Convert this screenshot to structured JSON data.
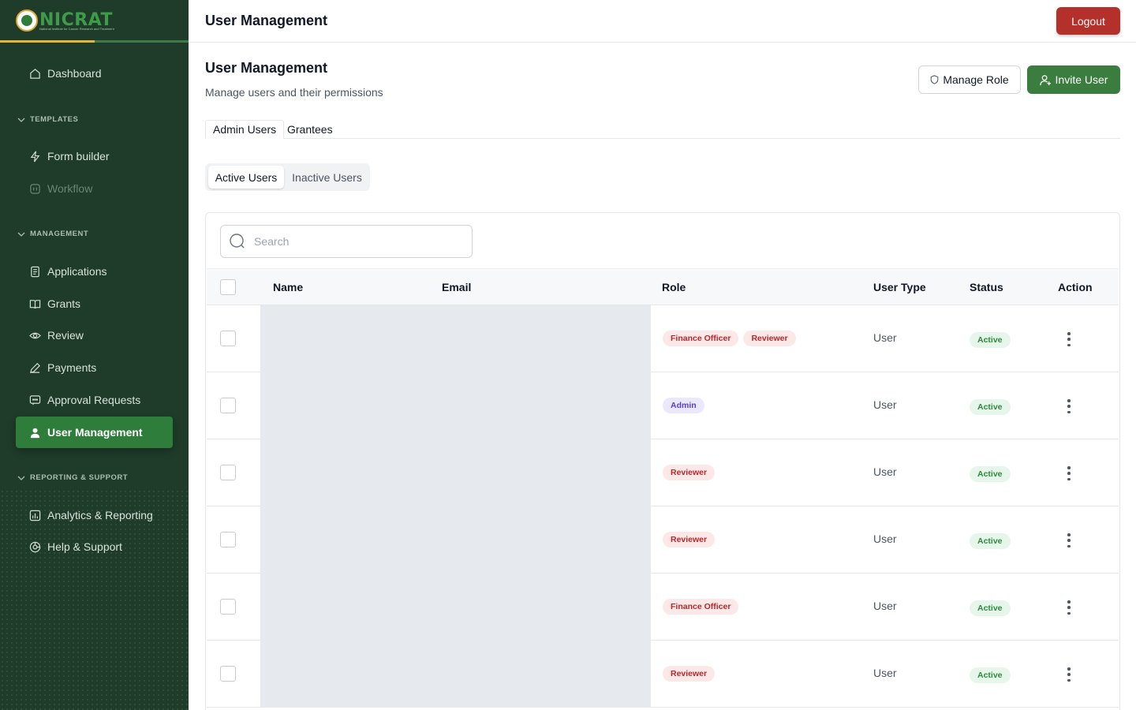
{
  "brand": {
    "name": "NICRAT",
    "tagline": "National Institute for Cancer Research and Treatment",
    "accent": "#2f7d3b",
    "gold": "#e5b43c"
  },
  "sidebar": {
    "dashboard": {
      "label": "Dashboard",
      "icon": "home-icon"
    },
    "sections": {
      "templates": "TEMPLATES",
      "management": "MANAGEMENT",
      "reporting": "REPORTING & SUPPORT"
    },
    "templates": [
      {
        "label": "Form builder",
        "icon": "bolt-icon"
      },
      {
        "label": "Workflow",
        "icon": "workflow-icon",
        "disabled": true
      }
    ],
    "management": [
      {
        "label": "Applications",
        "icon": "document-icon"
      },
      {
        "label": "Grants",
        "icon": "book-icon"
      },
      {
        "label": "Review",
        "icon": "eye-icon"
      },
      {
        "label": "Payments",
        "icon": "pen-icon"
      },
      {
        "label": "Approval Requests",
        "icon": "message-icon"
      },
      {
        "label": "User Management",
        "icon": "user-icon",
        "active": true
      }
    ],
    "reporting": [
      {
        "label": "Analytics & Reporting",
        "icon": "chart-icon"
      },
      {
        "label": "Help & Support",
        "icon": "help-icon"
      }
    ]
  },
  "header": {
    "title": "User Management",
    "logout_label": "Logout"
  },
  "main": {
    "title": "User Management",
    "subtitle": "Manage users and their permissions",
    "manage_role_label": "Manage Role",
    "invite_user_label": "Invite User",
    "tabs": [
      {
        "label": "Admin Users",
        "active": true
      },
      {
        "label": "Grantees"
      }
    ],
    "segments": [
      {
        "label": "Active Users",
        "active": true
      },
      {
        "label": "Inactive Users"
      }
    ],
    "search": {
      "placeholder": "Search",
      "value": ""
    },
    "columns": {
      "name": "Name",
      "email": "Email",
      "role": "Role",
      "user_type": "User Type",
      "status": "Status",
      "action": "Action"
    },
    "rows": [
      {
        "roles": [
          "Finance Officer",
          "Reviewer"
        ],
        "user_type": "User",
        "status": "Active"
      },
      {
        "roles": [
          "Admin"
        ],
        "user_type": "User",
        "status": "Active"
      },
      {
        "roles": [
          "Reviewer"
        ],
        "user_type": "User",
        "status": "Active"
      },
      {
        "roles": [
          "Reviewer"
        ],
        "user_type": "User",
        "status": "Active"
      },
      {
        "roles": [
          "Finance Officer"
        ],
        "user_type": "User",
        "status": "Active"
      },
      {
        "roles": [
          "Reviewer"
        ],
        "user_type": "User",
        "status": "Active"
      }
    ]
  }
}
